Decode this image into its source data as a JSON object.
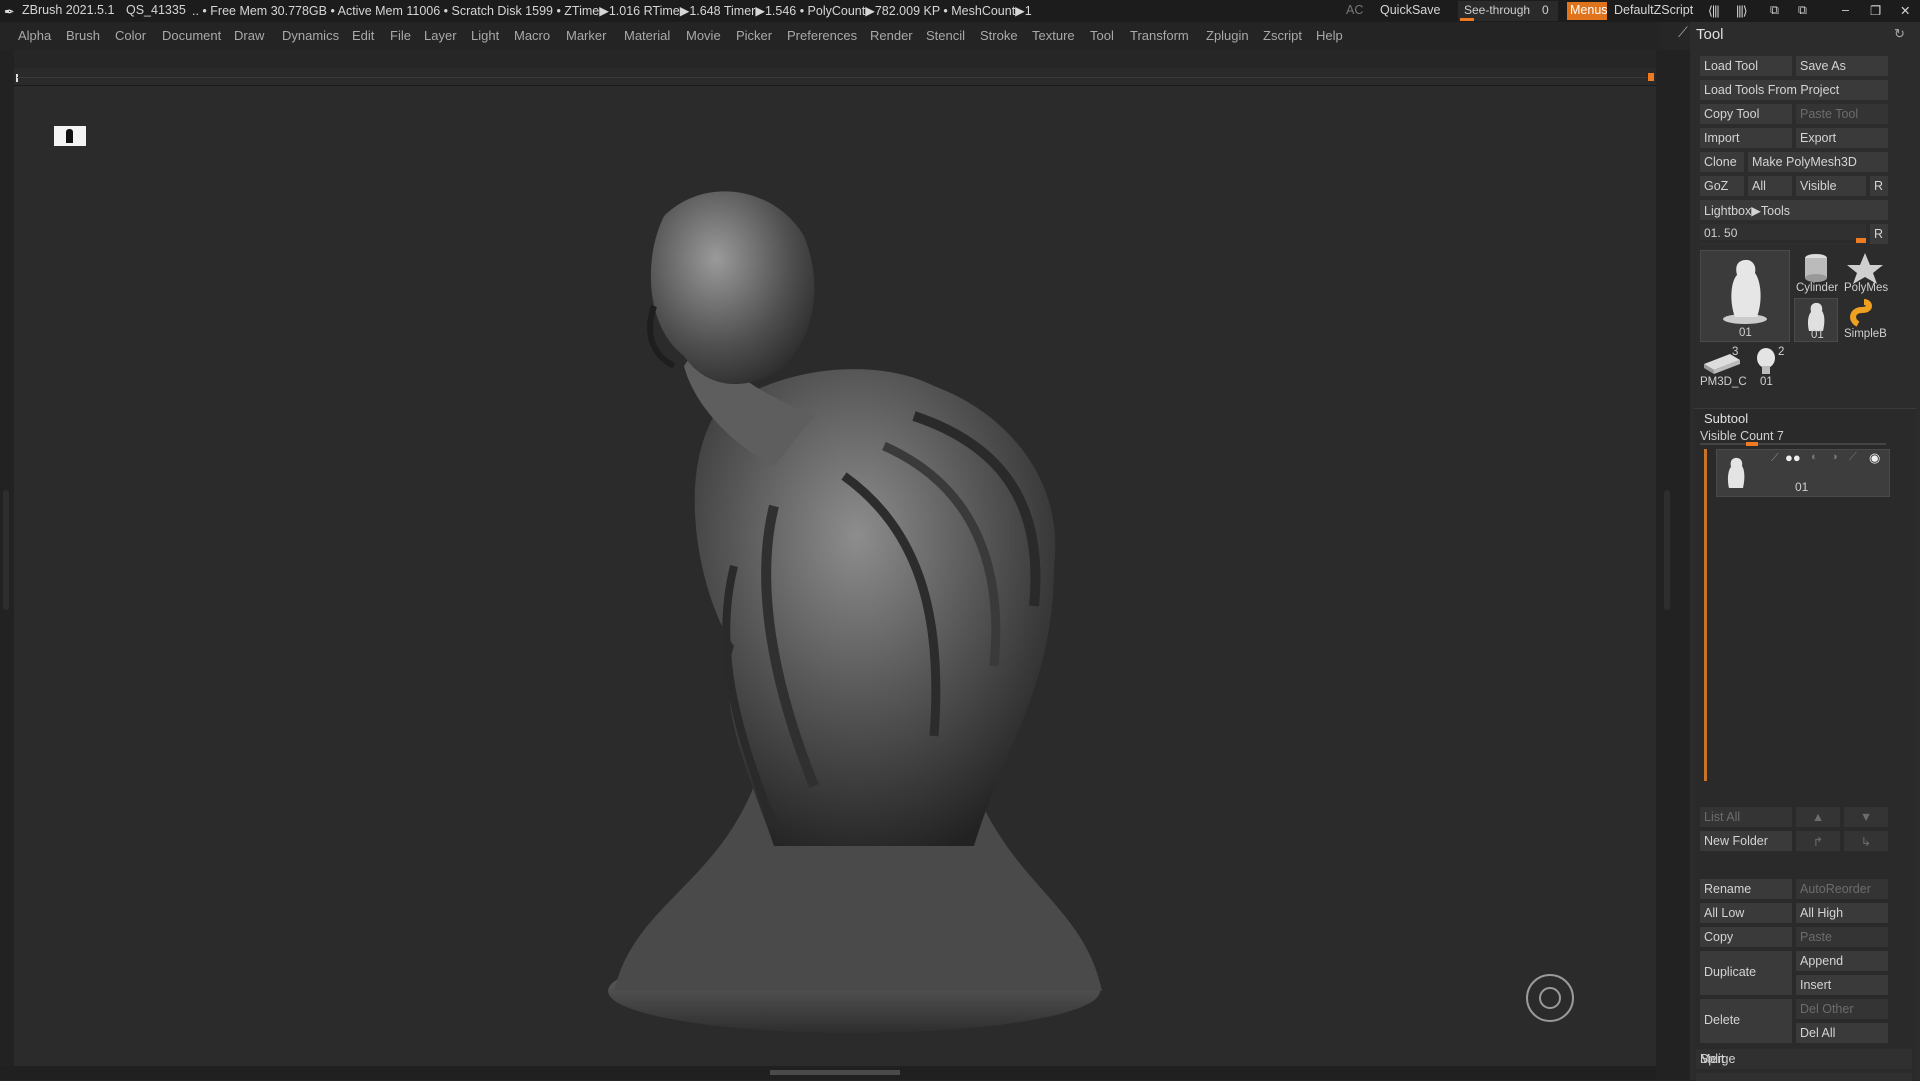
{
  "titlebar": {
    "app": "ZBrush 2021.5.1",
    "session": "QS_41335",
    "stats": ".. • Free Mem 30.778GB • Active Mem 11006 • Scratch Disk 1599 • ZTime▶1.016 RTime▶1.648 Timer▶1.546 • PolyCount▶782.009 KP • MeshCount▶1",
    "ac": "AC",
    "quicksave": "QuickSave",
    "seethrough_label": "See-through",
    "seethrough_value": "0",
    "menus": "Menus",
    "script": "DefaultZScript"
  },
  "menus": [
    "Alpha",
    "Brush",
    "Color",
    "Document",
    "Draw",
    "Dynamics",
    "Edit",
    "File",
    "Layer",
    "Light",
    "Macro",
    "Marker",
    "Material",
    "Movie",
    "Picker",
    "Preferences",
    "Render",
    "Stencil",
    "Stroke",
    "Texture",
    "Tool",
    "Transform",
    "Zplugin",
    "Zscript",
    "Help"
  ],
  "tool_panel": {
    "title": "Tool",
    "load_tool": "Load Tool",
    "save_as": "Save As",
    "load_from_project": "Load Tools From Project",
    "copy_tool": "Copy Tool",
    "paste_tool": "Paste Tool",
    "import": "Import",
    "export": "Export",
    "clone": "Clone",
    "make_polymesh": "Make PolyMesh3D",
    "goz": "GoZ",
    "all": "All",
    "visible": "Visible",
    "r": "R",
    "lightbox": "Lightbox▶Tools",
    "slider_value": "01. 50",
    "thumbs": {
      "main": "01",
      "cylinder": "Cylinder",
      "polymesh": "PolyMes",
      "small": "01",
      "simpleb": "SimpleB",
      "pm3d": "PM3D_C",
      "pm3d_num": "3",
      "head": "01",
      "head_num": "2"
    }
  },
  "subtool": {
    "title": "Subtool",
    "visible_count": "Visible Count 7",
    "item_label": "01",
    "list_all": "List All",
    "new_folder": "New Folder",
    "rename": "Rename",
    "autoreorder": "AutoReorder",
    "all_low": "All Low",
    "all_high": "All High",
    "copy": "Copy",
    "paste": "Paste",
    "duplicate": "Duplicate",
    "append": "Append",
    "insert": "Insert",
    "delete": "Delete",
    "del_other": "Del Other",
    "del_all": "Del All",
    "split": "Split",
    "merge": "Merge"
  },
  "colors": {
    "accent": "#f07a1f",
    "bg": "#262626"
  }
}
